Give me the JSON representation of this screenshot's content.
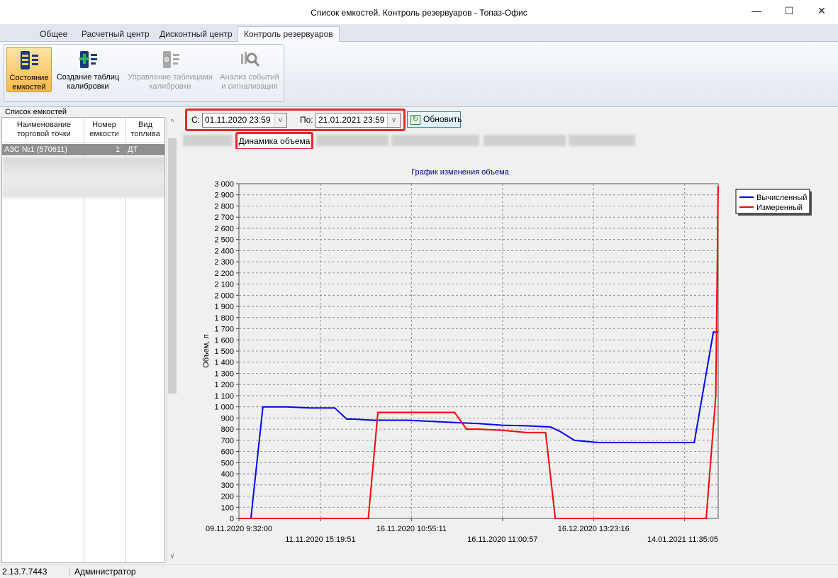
{
  "window": {
    "title": "Список емкостей. Контроль резервуаров - Топаз-Офис",
    "min_glyph": "—",
    "max_glyph": "☐",
    "close_glyph": "✕"
  },
  "ribbon_tabs": [
    "Общее",
    "Расчетный центр",
    "Дисконтный центр",
    "Контроль резервуаров"
  ],
  "ribbon_buttons": [
    {
      "line1": "Состояние",
      "line2": "емкостей",
      "icon": "tank-state-icon",
      "state": "active"
    },
    {
      "line1": "Создание таблиц",
      "line2": "калибровки",
      "icon": "create-calibration-icon",
      "state": "enabled"
    },
    {
      "line1": "Управление таблицами",
      "line2": "калибровки",
      "icon": "manage-calibration-icon",
      "state": "disabled"
    },
    {
      "line1": "Анализ событий",
      "line2": "и сигнализация",
      "icon": "event-analysis-icon",
      "state": "disabled"
    }
  ],
  "tank_list": {
    "title": "Список емкостей",
    "headers": {
      "col1_line1": "Наименование",
      "col1_line2": "торговой точки",
      "col2_line1": "Номер",
      "col2_line2": "емкости",
      "col3_line1": "Вид",
      "col3_line2": "топлива"
    },
    "selected_row": {
      "name": "АЗС №1 (570611)",
      "number": "1",
      "fuel": "ДТ"
    },
    "scroll_up": "^",
    "scroll_down": "v"
  },
  "filter": {
    "from_label": "С:",
    "from_value": "01.11.2020 23:59",
    "to_label": "По:",
    "to_value": "21.01.2021 23:59",
    "dropdown_glyph": "v",
    "refresh_label": "Обновить",
    "refresh_glyph": "↻"
  },
  "active_tab": "Динамика объема",
  "chart_data": {
    "type": "line",
    "title": "График изменения объема",
    "xlabel": "",
    "ylabel": "Объем, л",
    "ylim": [
      0,
      3000
    ],
    "y_ticks": [
      "0",
      "100",
      "200",
      "300",
      "400",
      "500",
      "600",
      "700",
      "800",
      "900",
      "1 000",
      "1 100",
      "1 200",
      "1 300",
      "1 400",
      "1 500",
      "1 600",
      "1 700",
      "1 800",
      "1 900",
      "2 000",
      "2 100",
      "2 200",
      "2 300",
      "2 400",
      "2 500",
      "2 600",
      "2 700",
      "2 800",
      "2 900",
      "3 000"
    ],
    "x_tick_labels_upper": [
      "09.11.2020 9:32:00",
      "16.11.2020 10:55:11",
      "16.12.2020 13:23:16"
    ],
    "x_tick_labels_lower": [
      "11.11.2020 15:19:51",
      "16.11.2020 11:00:57",
      "14.01.2021 11:35:05"
    ],
    "grid": true,
    "legend_position": "top-right",
    "series": [
      {
        "name": "Вычисленный",
        "color": "#0000ff",
        "x": [
          0,
          2.5,
          5,
          10,
          15,
          20,
          22.5,
          24,
          28,
          35,
          40,
          45,
          50,
          55,
          60,
          65,
          67,
          70,
          75,
          80,
          85,
          90,
          93,
          95,
          99,
          100
        ],
        "values": [
          0,
          0,
          1000,
          1000,
          990,
          990,
          890,
          890,
          880,
          880,
          870,
          860,
          850,
          835,
          830,
          820,
          780,
          700,
          680,
          680,
          680,
          680,
          680,
          680,
          1670,
          1670
        ]
      },
      {
        "name": "Измеренный",
        "color": "#ff0000",
        "x": [
          0,
          27,
          29,
          30,
          35,
          40,
          45,
          47.5,
          50,
          55,
          60,
          64,
          66,
          70,
          80,
          90,
          97.5,
          99.5,
          100
        ],
        "values": [
          0,
          0,
          950,
          950,
          950,
          950,
          950,
          800,
          800,
          790,
          770,
          770,
          0,
          0,
          0,
          0,
          0,
          1100,
          2980
        ]
      }
    ]
  },
  "status": {
    "version": "2.13.7.7443",
    "user": "Администратор"
  }
}
